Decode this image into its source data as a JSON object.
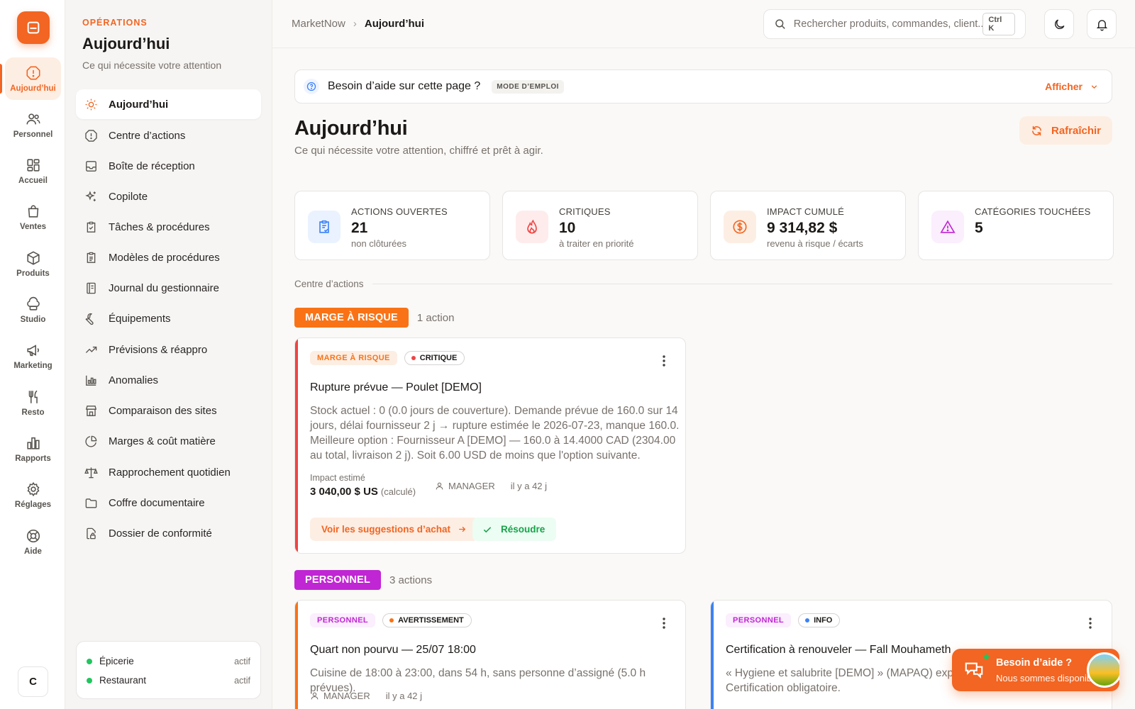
{
  "rail": {
    "items": [
      {
        "label": "Aujourd’hui",
        "icon": "alert-octagon-icon",
        "active": true
      },
      {
        "label": "Personnel",
        "icon": "users-icon"
      },
      {
        "label": "Accueil",
        "icon": "dashboard-grid-icon"
      },
      {
        "label": "Ventes",
        "icon": "shopping-bag-icon"
      },
      {
        "label": "Produits",
        "icon": "package-icon"
      },
      {
        "label": "Studio",
        "icon": "chef-hat-icon"
      },
      {
        "label": "Marketing",
        "icon": "megaphone-icon"
      },
      {
        "label": "Resto",
        "icon": "utensils-icon"
      },
      {
        "label": "Rapports",
        "icon": "bar-chart-icon"
      },
      {
        "label": "Réglages",
        "icon": "gear-icon"
      },
      {
        "label": "Aide",
        "icon": "lifebuoy-icon"
      }
    ],
    "avatar": "C"
  },
  "subnav": {
    "eyebrow": "OPÉRATIONS",
    "title": "Aujourd’hui",
    "subtitle": "Ce qui nécessite votre attention",
    "items": [
      {
        "label": "Aujourd’hui",
        "icon": "sun-icon",
        "active": true
      },
      {
        "label": "Centre d’actions",
        "icon": "alert-octagon-icon"
      },
      {
        "label": "Boîte de réception",
        "icon": "inbox-icon"
      },
      {
        "label": "Copilote",
        "icon": "sparkles-icon"
      },
      {
        "label": "Tâches & procédures",
        "icon": "clipboard-check-icon"
      },
      {
        "label": "Modèles de procédures",
        "icon": "clipboard-list-icon"
      },
      {
        "label": "Journal du gestionnaire",
        "icon": "notebook-icon"
      },
      {
        "label": "Équipements",
        "icon": "wrench-icon"
      },
      {
        "label": "Prévisions & réappro",
        "icon": "trending-up-icon"
      },
      {
        "label": "Anomalies",
        "icon": "bar-chart-icon"
      },
      {
        "label": "Comparaison des sites",
        "icon": "store-icon"
      },
      {
        "label": "Marges & coût matière",
        "icon": "pie-chart-icon"
      },
      {
        "label": "Rapprochement quotidien",
        "icon": "scale-icon"
      },
      {
        "label": "Coffre documentaire",
        "icon": "folder-icon"
      },
      {
        "label": "Dossier de conformité",
        "icon": "file-lock-icon"
      }
    ],
    "sites": [
      {
        "name": "Épicerie",
        "state": "actif"
      },
      {
        "name": "Restaurant",
        "state": "actif"
      }
    ]
  },
  "topbar": {
    "breadcrumb_root": "MarketNow",
    "breadcrumb_sep": "›",
    "breadcrumb_current": "Aujourd’hui",
    "search_placeholder": "Rechercher produits, commandes, client...",
    "search_kbd": "Ctrl K"
  },
  "help": {
    "text": "Besoin d’aide sur cette page ?",
    "chip": "MODE D’EMPLOI",
    "toggle": "Afficher"
  },
  "page": {
    "title": "Aujourd’hui",
    "subtitle": "Ce qui nécessite votre attention, chiffré et prêt à agir.",
    "refresh": "Rafraîchir"
  },
  "stats": [
    {
      "label": "ACTIONS OUVERTES",
      "value": "21",
      "note": "non clôturées",
      "icon": "clipboard-check-icon",
      "color": "#3b82f6"
    },
    {
      "label": "CRITIQUES",
      "value": "10",
      "note": "à traiter en priorité",
      "icon": "flame-icon",
      "color": "#ef4444"
    },
    {
      "label": "IMPACT CUMULÉ",
      "value": "9 314,82 $",
      "note": "revenu à risque / écarts",
      "icon": "dollar-coin-icon",
      "color": "#f26522"
    },
    {
      "label": "CATÉGORIES TOUCHÉES",
      "value": "5",
      "note": "",
      "icon": "warning-triangle-icon",
      "color": "#c026d3"
    }
  ],
  "section": {
    "title": "Centre d’actions"
  },
  "groups": {
    "marge": {
      "tag": "MARGE À RISQUE",
      "count": "1 action",
      "color": "#f97316"
    },
    "personnel": {
      "tag": "PERSONNEL",
      "count": "3 actions",
      "color": "#c026d3"
    }
  },
  "cards": {
    "rupture": {
      "category": "MARGE À RISQUE",
      "severity": "CRITIQUE",
      "title": "Rupture prévue — Poulet [DEMO]",
      "description": "Stock actuel : 0 (0.0 jours de couverture). Demande prévue de 160.0 sur 14 jours, délai fournisseur 2 j → rupture estimée le 2026-07-23, manque 160.0. Meilleure option : Fournisseur A [DEMO] — 160.0 à 14.4000 CAD (2304.00 au total, livraison 2 j). Soit 6.00 USD de moins que l'option suivante.",
      "impact_label": "Impact estimé",
      "impact_value": "3 040,00 $ US",
      "impact_calc": "(calculé)",
      "role": "MANAGER",
      "ago": "il y a 42 j",
      "primary_action": "Voir les suggestions d’achat",
      "resolve_action": "Résoudre"
    },
    "quart": {
      "category": "PERSONNEL",
      "severity": "AVERTISSEMENT",
      "title": "Quart non pourvu — 25/07 18:00",
      "description": "Cuisine de 18:00 à 23:00, dans 54 h, sans personne d’assigné (5.0 h prévues).",
      "role": "MANAGER",
      "ago": "il y a 42 j"
    },
    "certif": {
      "category": "PERSONNEL",
      "severity": "INFO",
      "title": "Certification à renouveler — Fall Mouhameth",
      "description": "« Hygiene et salubrite [DEMO] » (MAPAQ) expire dans 5 jour(s). Certification obligatoire."
    }
  },
  "help_float": {
    "title": "Besoin d’aide ?",
    "subtitle": "Nous sommes disponibles"
  }
}
